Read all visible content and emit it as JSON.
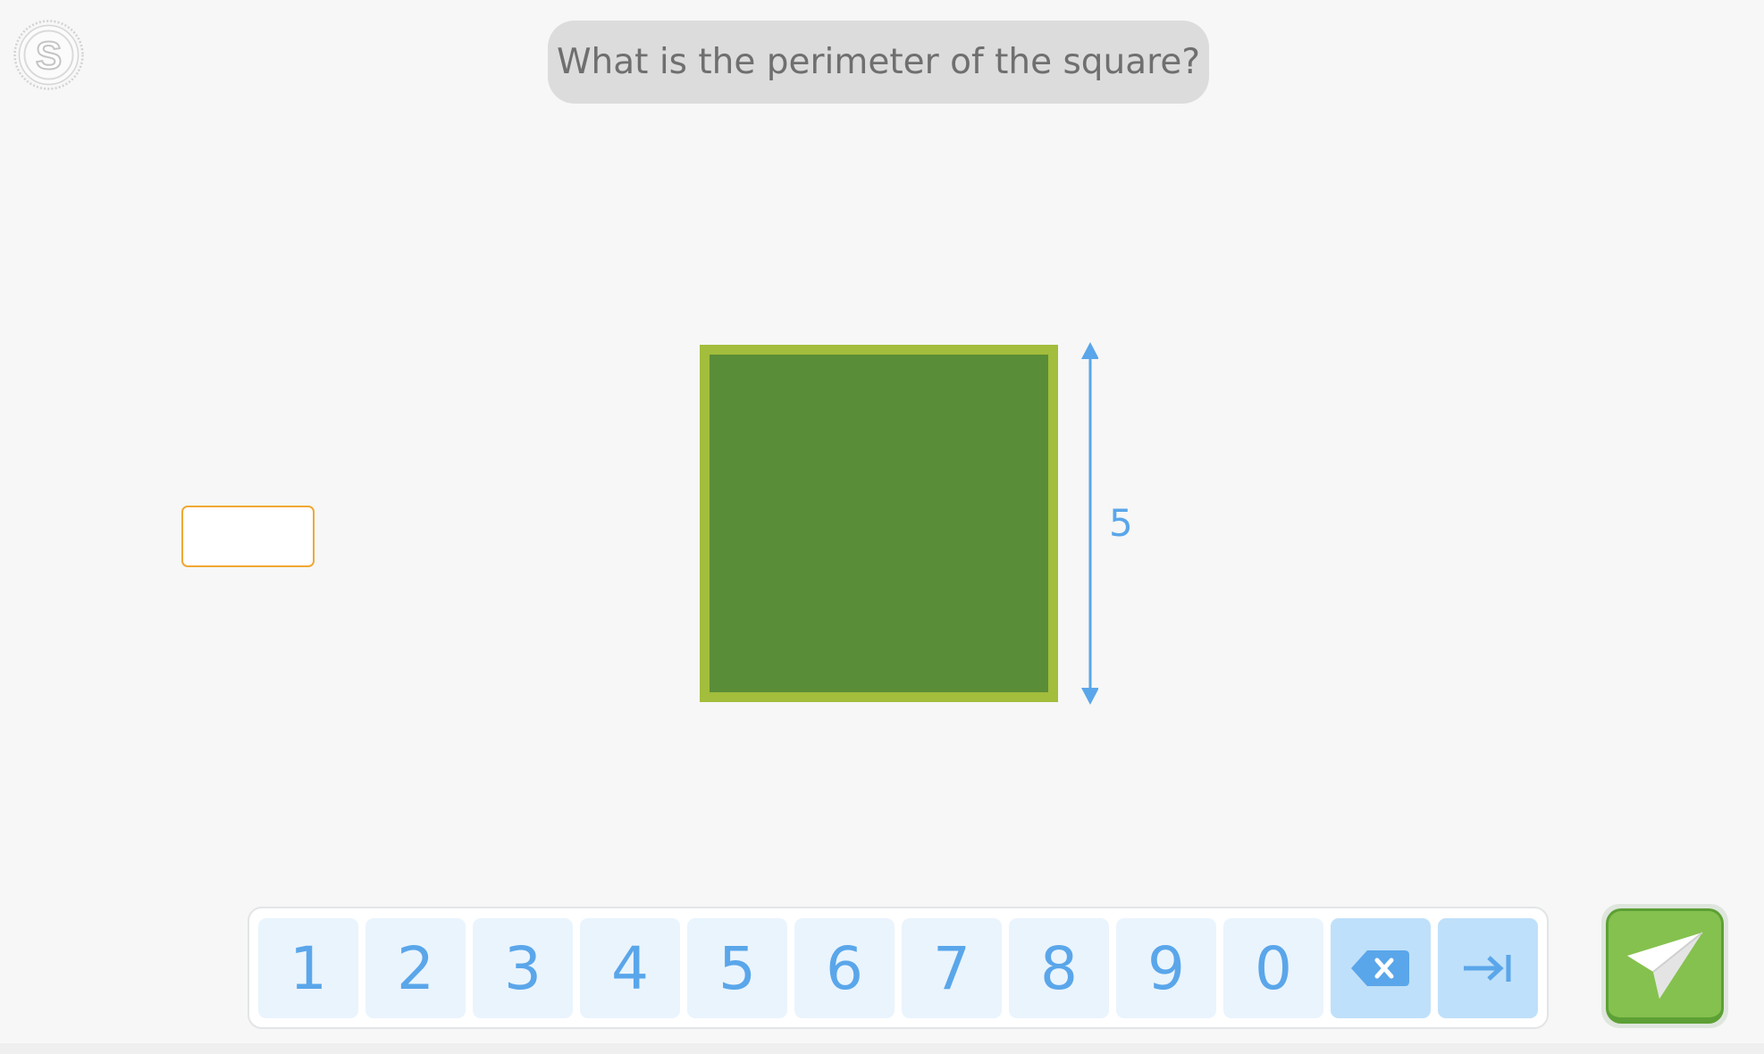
{
  "logo": {
    "letter": "S"
  },
  "question": {
    "text": "What is the perimeter of the square?"
  },
  "answer": {
    "value": "",
    "placeholder": ""
  },
  "figure": {
    "side_label": "5",
    "colors": {
      "fill": "#5a8d37",
      "border": "#a3bd3c",
      "dimension": "#5aa6ea"
    }
  },
  "keypad": {
    "keys": [
      "1",
      "2",
      "3",
      "4",
      "5",
      "6",
      "7",
      "8",
      "9",
      "0"
    ],
    "backspace_icon": "backspace-icon",
    "tab_icon": "tab-arrow-icon"
  },
  "submit": {
    "icon": "paper-plane-icon",
    "color": "#85c14f"
  }
}
